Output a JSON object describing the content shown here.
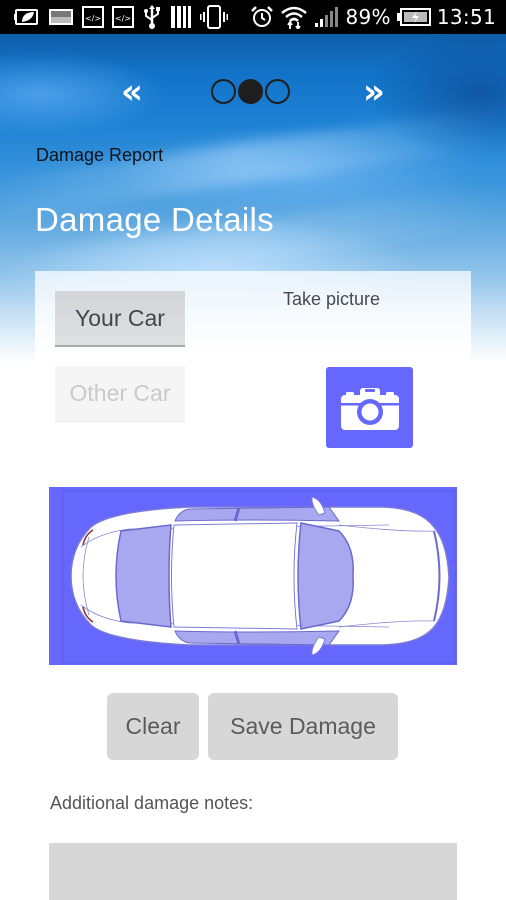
{
  "status_bar": {
    "left_icons": [
      "battery-saver-icon",
      "image-icon",
      "code-icon",
      "code-icon",
      "usb-icon",
      "barcode-icon",
      "vibrate-icon"
    ],
    "right_icons": [
      "alarm-icon",
      "wifi-icon",
      "signal-icon",
      "battery-charging-icon"
    ],
    "battery_percent": "89%",
    "time": "13:51"
  },
  "pager": {
    "prev_glyph": "«",
    "next_glyph": "»",
    "page_count": 3,
    "current_page": 2
  },
  "header": {
    "subtitle": "Damage Report",
    "title": "Damage Details"
  },
  "car_selector": {
    "your_car_label": "Your Car",
    "other_car_label": "Other Car",
    "selected": "Your Car"
  },
  "camera": {
    "label": "Take picture",
    "icon": "camera-icon"
  },
  "actions": {
    "clear_label": "Clear",
    "save_label": "Save Damage"
  },
  "notes": {
    "label": "Additional damage notes:",
    "value": ""
  },
  "colors": {
    "accent": "#6667fd",
    "button_gray": "#d7d7d7",
    "glass_tint": "#a8a8f0"
  }
}
